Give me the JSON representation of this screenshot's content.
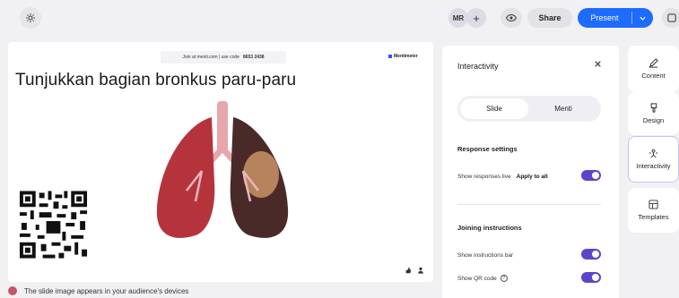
{
  "topbar": {
    "settings_icon": "gear-icon",
    "avatar_initials": "MR",
    "add_icon": "+",
    "preview_icon": "eye-icon",
    "share_label": "Share",
    "present_label": "Present",
    "present_menu_icon": "chevron-down-icon",
    "extra_icon": "keyboard-icon",
    "accent_color": "#1e6bff"
  },
  "slide": {
    "join_text": "Join at menti.com | use code",
    "join_code": "8653 2438",
    "brand": "Mentimeter",
    "title": "Tunjukkan bagian bronkus paru-paru",
    "image_subject": "lungs-illustration",
    "qr": "qr-code"
  },
  "caption": "The slide image appears in your audience's devices",
  "panel": {
    "title": "Interactivity",
    "close_icon": "close-icon",
    "tabs": [
      {
        "label": "Slide",
        "active": true
      },
      {
        "label": "Menti",
        "active": false
      }
    ],
    "response_settings": {
      "heading": "Response settings",
      "show_live_label": "Show responses live",
      "apply_label": "Apply to all",
      "show_live_on": true
    },
    "joining": {
      "heading": "Joining instructions",
      "bar_label": "Show instructions bar",
      "bar_on": true,
      "qr_label": "Show QR code",
      "qr_help": "?",
      "qr_on": true
    },
    "toggle_color": "#5b45c9"
  },
  "rail": [
    {
      "label": "Content",
      "icon": "pencil-icon"
    },
    {
      "label": "Design",
      "icon": "brush-icon"
    },
    {
      "label": "Interactivity",
      "icon": "interactivity-icon",
      "active": true
    },
    {
      "label": "Templates",
      "icon": "templates-icon"
    }
  ]
}
